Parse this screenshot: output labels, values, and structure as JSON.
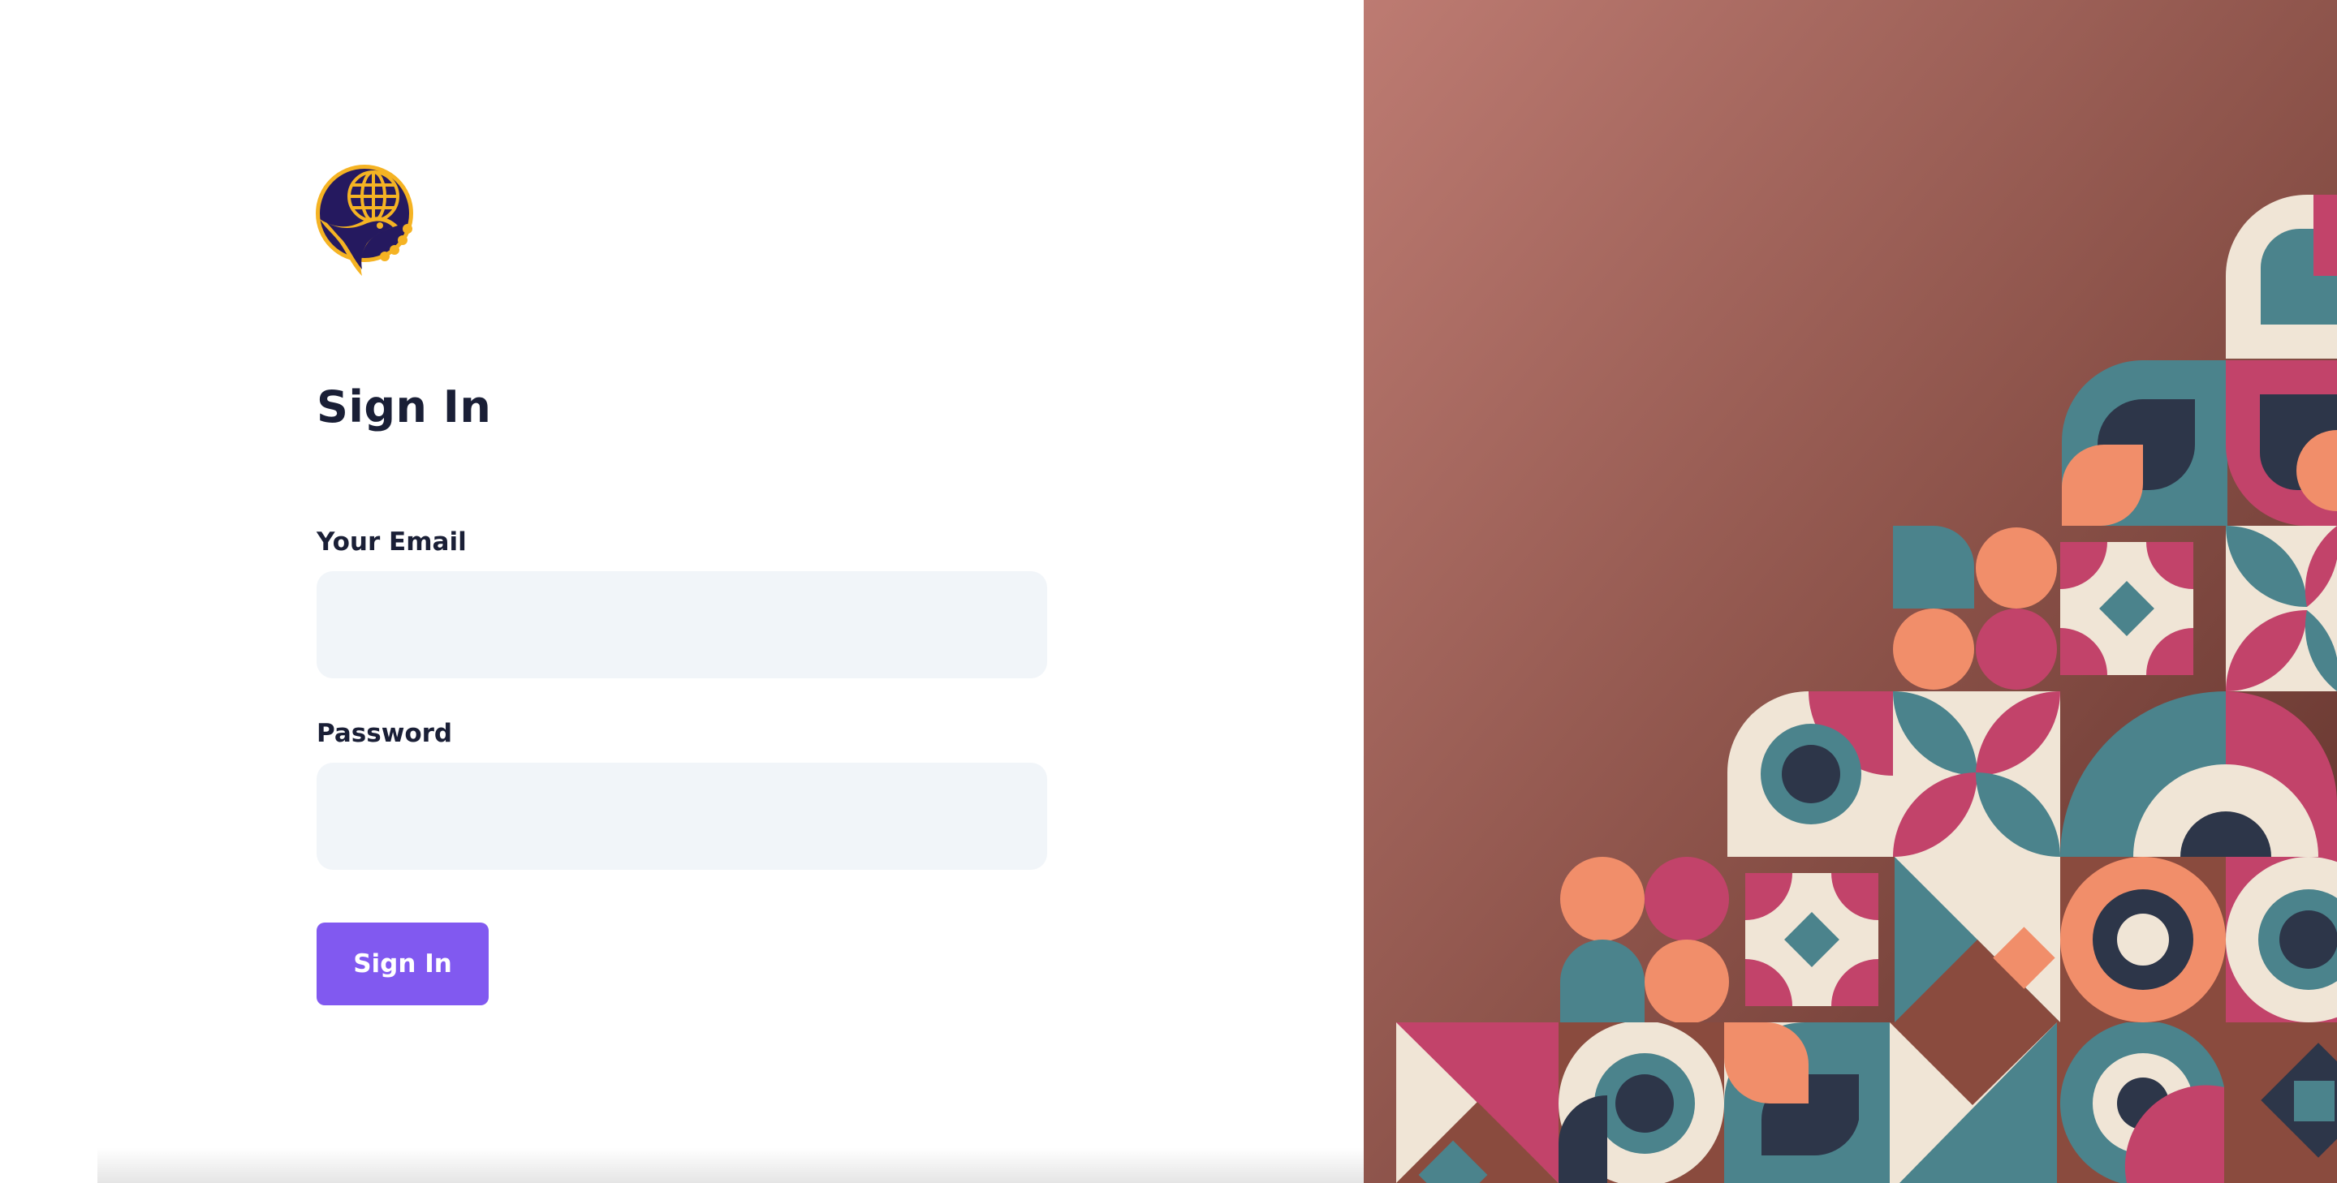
{
  "page": {
    "title": "Sign In"
  },
  "logo": {
    "icon": "globe-bird-emblem-icon"
  },
  "form": {
    "email_label": "Your Email",
    "email_value": "",
    "email_placeholder": "",
    "password_label": "Password",
    "password_value": "",
    "password_placeholder": "",
    "submit_label": "Sign In"
  },
  "colors": {
    "accent": "#8159f0",
    "heading": "#1a1f36",
    "input_background": "#f1f5f9",
    "panel_gradient_top": "#bd7b72",
    "panel_gradient_bottom": "#5c2e28",
    "pattern_teal": "#4b838c",
    "pattern_pink": "#c2436a",
    "pattern_peach": "#f18e6a",
    "pattern_cream": "#f0e5d6",
    "pattern_navy": "#2d3649"
  }
}
